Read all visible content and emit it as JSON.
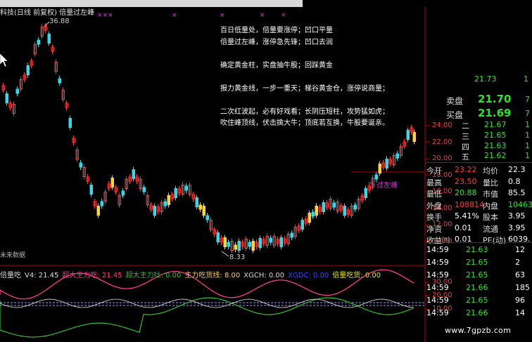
{
  "window": {
    "title": "科技(日线 前复权) 倍量过左峰",
    "high_label": "36.88",
    "low_label": "8.33",
    "breakout_label": "过左峰",
    "future_label": "未来数据",
    "x_marks": [
      "×××",
      "×",
      "×",
      "×",
      "×"
    ]
  },
  "notes": [
    "百日低量处，倍量要涨停；凹口平量",
    "倍量过左峰，涨停急先锋；凹口去润",
    "",
    "确定黄金柱，实盘抽牛股；回踩黄金",
    "",
    "报力黄金线，一步一重天；梯谷黄金仓，涨停说商量；",
    "",
    "二次红波起，必有好戏看；长阴压短柱，攻势猛如虎；",
    "吹住峰顶线，伏击擒大牛；顶底若互换，牛股要诞亲。"
  ],
  "indicator": {
    "name": "倍量吃",
    "v4_label": "V4: 21.45",
    "main_absorb": "超大主力吃: 21.45",
    "main_spit": "超大主力吐: 0.00",
    "main_dump": "主力吃货线: 8.00",
    "xgch": "XGCH: 0.00",
    "xgdc": "XGDC: 0.00",
    "bulk_absorb": "倍量吃货: 0.00"
  },
  "order_book": {
    "sell_label": "卖盘",
    "buy_label": "买盘",
    "sell_top_price": "21.73",
    "sell_price": "21.70",
    "buy_price": "21.69",
    "buy_levels": [
      {
        "level": "二",
        "price": "21.67"
      },
      {
        "level": "三",
        "price": "21.65"
      },
      {
        "level": "四",
        "price": "21.63"
      },
      {
        "level": "五",
        "price": "21.62"
      }
    ],
    "right_top_value": "1",
    "right_sell_value": "7",
    "right_buy_value": "7",
    "right_lvl_values": [
      "1",
      "1",
      "1",
      "1"
    ]
  },
  "stats": [
    {
      "l1": "今开",
      "v1": "23.22",
      "l2": "均价",
      "v2": "22.3"
    },
    {
      "l1": "最高",
      "v1": "23.50",
      "l2": "量比",
      "v2": "0.8"
    },
    {
      "l1": "最低",
      "v1": "20.88",
      "l2": "市值",
      "v2": "85.5"
    },
    {
      "l1": "外盘",
      "v1": "108814",
      "l2": "内盘",
      "v2": "10463"
    },
    {
      "l1": "换手",
      "v1": "5.41%",
      "l2": "股本",
      "v2": "3.95"
    },
    {
      "l1": "净资",
      "v1": "0.01",
      "l2": "流通",
      "v2": "3.95"
    },
    {
      "l1": "收益㈢",
      "v1": "0.01",
      "l2": "PE(动)",
      "v2": "6039."
    }
  ],
  "ticks": [
    {
      "time": "14:59",
      "price": "21.63",
      "vol": "12"
    },
    {
      "time": "14:59",
      "price": "21.65",
      "vol": "2"
    },
    {
      "time": "14:59",
      "price": "21.65",
      "vol": "63"
    },
    {
      "time": "14:59",
      "price": "21.66",
      "vol": "185"
    },
    {
      "time": "14:59",
      "price": "21.65",
      "vol": "96"
    },
    {
      "time": "14:59",
      "price": "21.66",
      "vol": "14"
    }
  ],
  "price_axis": [
    "24.00",
    "22.00",
    "20.00",
    "18.00",
    "16.00",
    "14.00",
    "12.00",
    "10.00"
  ],
  "ind_axis": [
    "30.00",
    "20.00",
    "10.00"
  ],
  "footer": {
    "site": "www.7gpzb.com"
  },
  "colors": {
    "up": "#ff3a3a",
    "down": "#35d8e8",
    "gold": "#ffd23c",
    "ind_pink": "#ff3a8c",
    "ind_green": "#30c030",
    "bg": "#000000"
  }
}
